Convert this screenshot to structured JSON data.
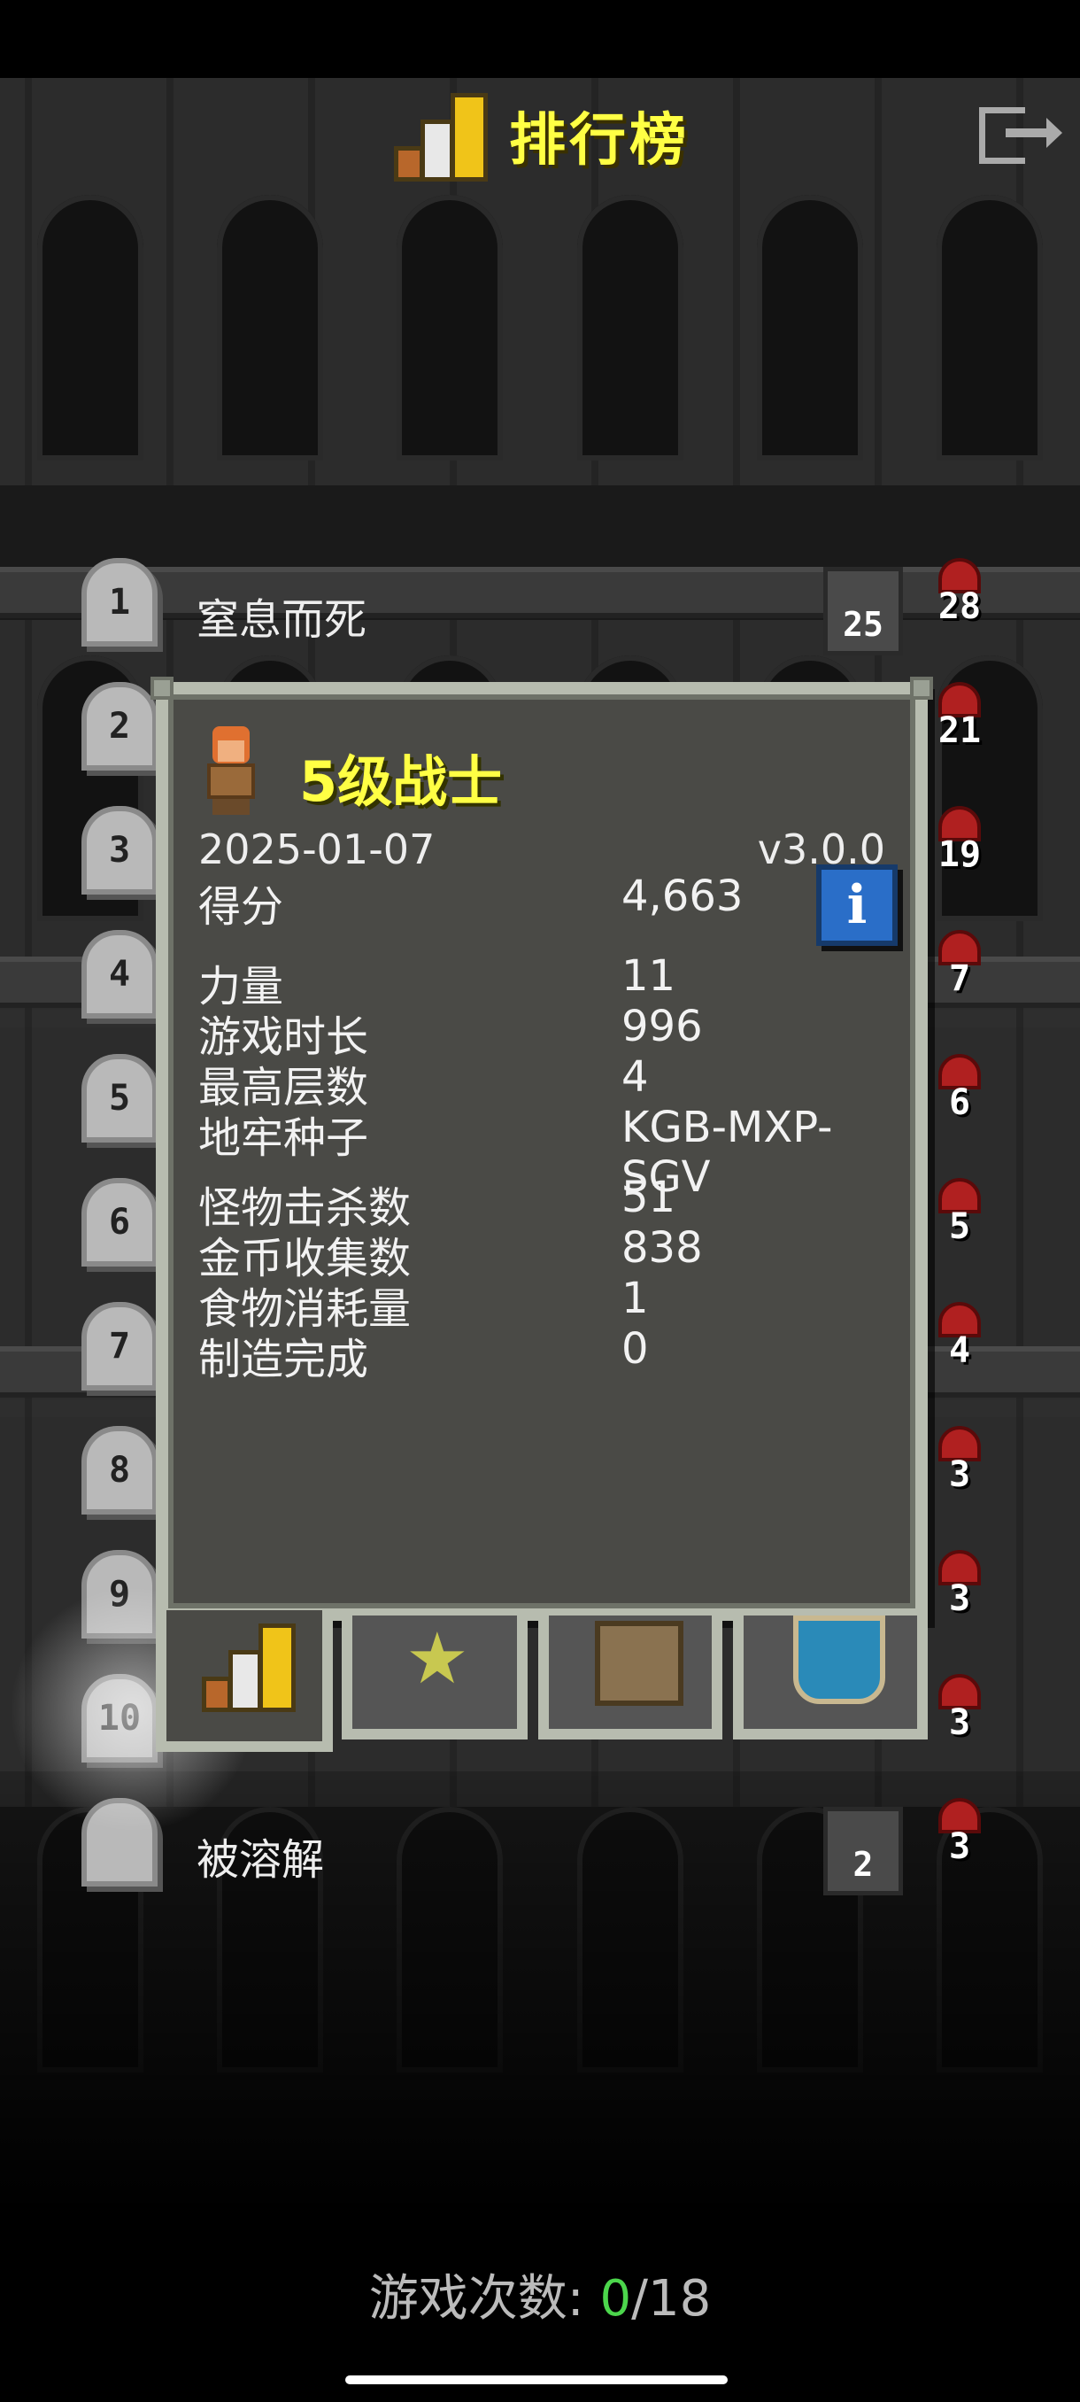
{
  "header": {
    "title": "排行榜",
    "icon": "podium-icon",
    "exit_icon": "exit-icon"
  },
  "rows": [
    {
      "rank": "1",
      "label": "窒息而死",
      "depth": "25",
      "level": "28"
    },
    {
      "rank": "2",
      "level": "21"
    },
    {
      "rank": "3",
      "level": "19"
    },
    {
      "rank": "4",
      "level": "7"
    },
    {
      "rank": "5",
      "level": "6"
    },
    {
      "rank": "6",
      "level": "5"
    },
    {
      "rank": "7",
      "level": "4"
    },
    {
      "rank": "8",
      "level": "3"
    },
    {
      "rank": "9",
      "level": "3"
    },
    {
      "rank": "10",
      "level": "3"
    },
    {
      "rank": "",
      "label": "被溶解",
      "depth": "2",
      "level": "3"
    }
  ],
  "detail": {
    "hero_title": "5级战士",
    "date": "2025-01-07",
    "version": "v3.0.0",
    "info_label": "i",
    "stats": [
      {
        "label": "得分",
        "value": "4,663"
      },
      {
        "label": "力量",
        "value": "11"
      },
      {
        "label": "游戏时长",
        "value": "996"
      },
      {
        "label": "最高层数",
        "value": "4"
      },
      {
        "label": "地牢种子",
        "value": "KGB-MXP-SGV"
      },
      {
        "label": "怪物击杀数",
        "value": "51"
      },
      {
        "label": "金币收集数",
        "value": "838"
      },
      {
        "label": "食物消耗量",
        "value": "1"
      },
      {
        "label": "制造完成",
        "value": "0"
      }
    ],
    "tabs": [
      {
        "name": "stats",
        "icon": "podium-icon"
      },
      {
        "name": "badges",
        "icon": "star-icon"
      },
      {
        "name": "items",
        "icon": "bag-icon"
      },
      {
        "name": "class",
        "icon": "badge-icon"
      }
    ]
  },
  "footer": {
    "label": "游戏次数:",
    "current": "0",
    "total": "/18"
  },
  "colors": {
    "title": "#ffff44",
    "highlight": "#4cd64c",
    "info": "#2a6ec8"
  }
}
